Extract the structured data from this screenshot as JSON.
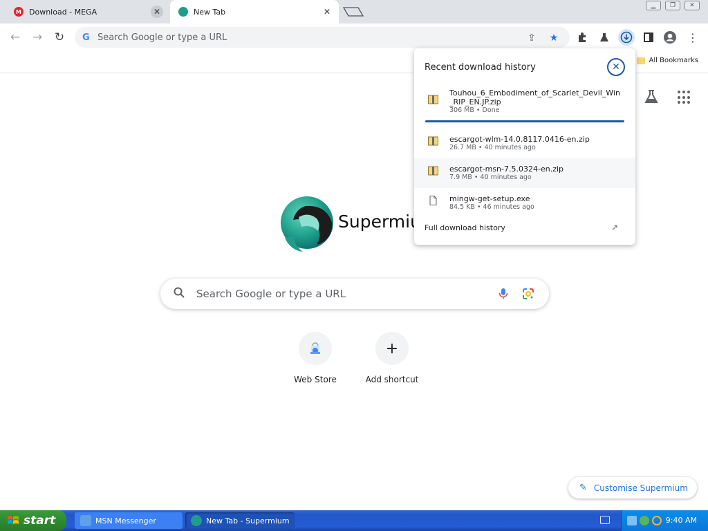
{
  "tabs": [
    {
      "title": "Download - MEGA",
      "favicon": "mega-icon",
      "close": "✕",
      "active": false
    },
    {
      "title": "New Tab",
      "favicon": "supermium-icon",
      "close": "✕",
      "active": true
    }
  ],
  "toolbar": {
    "omnibox_placeholder": "Search Google or type a URL"
  },
  "bookmarks": {
    "all_bookmarks_label": "All Bookmarks"
  },
  "ntp": {
    "brand_text": "Supermium",
    "search_placeholder": "Search Google or type a URL",
    "shortcuts": [
      {
        "label": "Web Store",
        "icon": "web-store-icon"
      },
      {
        "label": "Add shortcut",
        "icon": "plus-icon",
        "glyph": "+"
      }
    ],
    "customise_label": "Customise Supermium"
  },
  "downloads": {
    "header": "Recent download history",
    "items": [
      {
        "name": "Touhou_6_Embodiment_of_Scarlet_Devil_Win_RIP_EN.JP.zip",
        "meta": "306 MB • Done",
        "icon": "zip-file-icon"
      },
      {
        "name": "escargot-wlm-14.0.8117.0416-en.zip",
        "meta": "26.7 MB • 40 minutes ago",
        "icon": "zip-file-icon"
      },
      {
        "name": "escargot-msn-7.5.0324-en.zip",
        "meta": "7.9 MB • 40 minutes ago",
        "icon": "zip-file-icon"
      },
      {
        "name": "mingw-get-setup.exe",
        "meta": "84.5 KB • 46 minutes ago",
        "icon": "file-icon"
      }
    ],
    "footer": "Full download history"
  },
  "taskbar": {
    "start_label": "start",
    "buttons": [
      {
        "label": "MSN Messenger",
        "icon": "msn-icon"
      },
      {
        "label": "New Tab - Supermium",
        "icon": "supermium-icon"
      }
    ],
    "clock": "9:40 AM"
  },
  "colors": {
    "accent": "#1a73e8",
    "download_accent": "#1a56a8",
    "mega_red": "#d9272e",
    "taskbar_blue": "#245dd7",
    "start_green": "#2f8b2f"
  }
}
